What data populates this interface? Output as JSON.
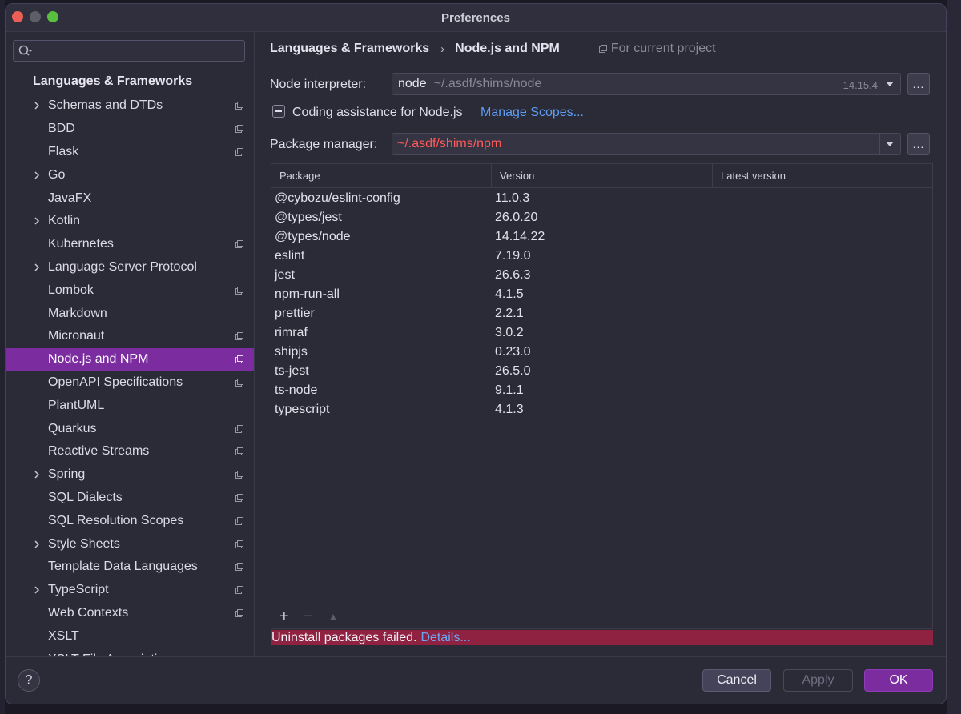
{
  "window": {
    "title": "Preferences"
  },
  "sidebar": {
    "search": {
      "placeholder": "",
      "value": ""
    },
    "root_label": "Languages & Frameworks",
    "items": [
      {
        "label": "Schemas and DTDs",
        "expandable": true,
        "project": true
      },
      {
        "label": "BDD",
        "expandable": false,
        "project": true
      },
      {
        "label": "Flask",
        "expandable": false,
        "project": true
      },
      {
        "label": "Go",
        "expandable": true,
        "project": false
      },
      {
        "label": "JavaFX",
        "expandable": false,
        "project": false
      },
      {
        "label": "Kotlin",
        "expandable": true,
        "project": false
      },
      {
        "label": "Kubernetes",
        "expandable": false,
        "project": true
      },
      {
        "label": "Language Server Protocol",
        "expandable": true,
        "project": false
      },
      {
        "label": "Lombok",
        "expandable": false,
        "project": true
      },
      {
        "label": "Markdown",
        "expandable": false,
        "project": false
      },
      {
        "label": "Micronaut",
        "expandable": false,
        "project": true
      },
      {
        "label": "Node.js and NPM",
        "expandable": false,
        "project": true,
        "selected": true
      },
      {
        "label": "OpenAPI Specifications",
        "expandable": false,
        "project": true
      },
      {
        "label": "PlantUML",
        "expandable": false,
        "project": false
      },
      {
        "label": "Quarkus",
        "expandable": false,
        "project": true
      },
      {
        "label": "Reactive Streams",
        "expandable": false,
        "project": true
      },
      {
        "label": "Spring",
        "expandable": true,
        "project": true
      },
      {
        "label": "SQL Dialects",
        "expandable": false,
        "project": true
      },
      {
        "label": "SQL Resolution Scopes",
        "expandable": false,
        "project": true
      },
      {
        "label": "Style Sheets",
        "expandable": true,
        "project": true
      },
      {
        "label": "Template Data Languages",
        "expandable": false,
        "project": true
      },
      {
        "label": "TypeScript",
        "expandable": true,
        "project": true
      },
      {
        "label": "Web Contexts",
        "expandable": false,
        "project": true
      },
      {
        "label": "XSLT",
        "expandable": false,
        "project": false
      },
      {
        "label": "XSLT File Associations",
        "expandable": false,
        "project": true
      }
    ]
  },
  "breadcrumb": {
    "parent": "Languages & Frameworks",
    "current": "Node.js and NPM",
    "scope": "For current project"
  },
  "node_interpreter": {
    "label": "Node interpreter:",
    "name": "node",
    "path": "~/.asdf/shims/node",
    "version": "14.15.4",
    "browse": "..."
  },
  "coding_assistance": {
    "label": "Coding assistance for Node.js",
    "link": "Manage Scopes..."
  },
  "package_manager": {
    "label": "Package manager:",
    "value": "~/.asdf/shims/npm",
    "browse": "..."
  },
  "packages_table": {
    "headers": [
      "Package",
      "Version",
      "Latest version"
    ],
    "rows": [
      {
        "package": "@cybozu/eslint-config",
        "version": "11.0.3",
        "latest": ""
      },
      {
        "package": "@types/jest",
        "version": "26.0.20",
        "latest": ""
      },
      {
        "package": "@types/node",
        "version": "14.14.22",
        "latest": ""
      },
      {
        "package": "eslint",
        "version": "7.19.0",
        "latest": ""
      },
      {
        "package": "jest",
        "version": "26.6.3",
        "latest": ""
      },
      {
        "package": "npm-run-all",
        "version": "4.1.5",
        "latest": ""
      },
      {
        "package": "prettier",
        "version": "2.2.1",
        "latest": ""
      },
      {
        "package": "rimraf",
        "version": "3.0.2",
        "latest": ""
      },
      {
        "package": "shipjs",
        "version": "0.23.0",
        "latest": ""
      },
      {
        "package": "ts-jest",
        "version": "26.5.0",
        "latest": ""
      },
      {
        "package": "ts-node",
        "version": "9.1.1",
        "latest": ""
      },
      {
        "package": "typescript",
        "version": "4.1.3",
        "latest": ""
      }
    ],
    "toolbar": {
      "add": "+",
      "remove": "−",
      "upgrade": "▲"
    }
  },
  "error": {
    "message": "Uninstall packages failed.",
    "link": "Details..."
  },
  "footer": {
    "help": "?",
    "cancel": "Cancel",
    "apply": "Apply",
    "ok": "OK"
  },
  "colors": {
    "accent": "#7b2da0",
    "error_bg": "#8f2240",
    "link": "#5e9ef2",
    "error_text": "#ff5a5a"
  }
}
